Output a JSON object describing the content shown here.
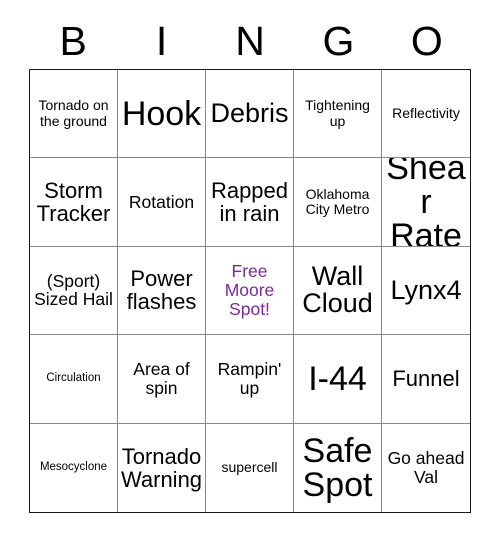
{
  "card": {
    "title_letters": [
      "B",
      "I",
      "N",
      "G",
      "O"
    ],
    "free_space_color": "#7b2a9b",
    "border_color": "#8a8a8a",
    "outer_border_color": "#1a1a1a",
    "text_color": "#000000",
    "background": "#ffffff"
  },
  "grid": {
    "columns": 5,
    "rows": 5,
    "cells": [
      {
        "text": "Tornado on the ground",
        "size": "sm",
        "free": false
      },
      {
        "text": "Hook",
        "size": "xxl",
        "free": false
      },
      {
        "text": "Debris",
        "size": "xl",
        "free": false
      },
      {
        "text": "Tightening up",
        "size": "sm",
        "free": false
      },
      {
        "text": "Reflectivity",
        "size": "sm",
        "free": false
      },
      {
        "text": "Storm Tracker",
        "size": "lg",
        "free": false
      },
      {
        "text": "Rotation",
        "size": "md",
        "free": false
      },
      {
        "text": "Rapped in rain",
        "size": "lg",
        "free": false
      },
      {
        "text": "Oklahoma City Metro",
        "size": "sm",
        "free": false
      },
      {
        "text": "Shear Rate",
        "size": "xxl",
        "free": false
      },
      {
        "text": "(Sport) Sized Hail",
        "size": "md",
        "free": false
      },
      {
        "text": "Power flashes",
        "size": "lg",
        "free": false
      },
      {
        "text": "Free Moore Spot!",
        "size": "md",
        "free": true
      },
      {
        "text": "Wall Cloud",
        "size": "xl",
        "free": false
      },
      {
        "text": "Lynx4",
        "size": "xl",
        "free": false
      },
      {
        "text": "Circulation",
        "size": "xs",
        "free": false
      },
      {
        "text": "Area of spin",
        "size": "md",
        "free": false
      },
      {
        "text": "Rampin' up",
        "size": "md",
        "free": false
      },
      {
        "text": "I-44",
        "size": "xxl",
        "free": false
      },
      {
        "text": "Funnel",
        "size": "lg",
        "free": false
      },
      {
        "text": "Mesocyclone",
        "size": "xs",
        "free": false
      },
      {
        "text": "Tornado Warning",
        "size": "lg",
        "free": false
      },
      {
        "text": "supercell",
        "size": "sm",
        "free": false
      },
      {
        "text": "Safe Spot",
        "size": "xxl",
        "free": false
      },
      {
        "text": "Go ahead Val",
        "size": "md",
        "free": false
      }
    ]
  }
}
